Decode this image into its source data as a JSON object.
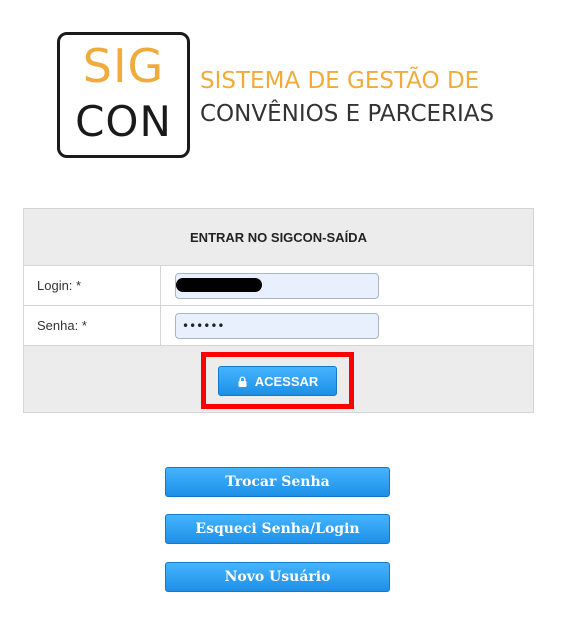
{
  "logo": {
    "line1": "SIG",
    "line2": "CON",
    "tagline_line1": "SISTEMA DE GESTÃO DE",
    "tagline_line2": "CONVÊNIOS E PARCERIAS",
    "accent_color": "#f0ab3d"
  },
  "login_panel": {
    "title": "ENTRAR NO SIGCON-SAÍDA",
    "login_label": "Login: *",
    "login_value": "",
    "senha_label": "Senha: *",
    "senha_value": "••••••",
    "submit_label": "ACESSAR",
    "submit_icon": "lock-icon"
  },
  "actions": {
    "trocar_senha": "Trocar Senha",
    "esqueci_senha": "Esqueci Senha/Login",
    "novo_usuario": "Novo Usuário"
  },
  "colors": {
    "button_blue": "#1d8fe6",
    "highlight_red": "#ff0000",
    "panel_gray": "#ececec"
  }
}
